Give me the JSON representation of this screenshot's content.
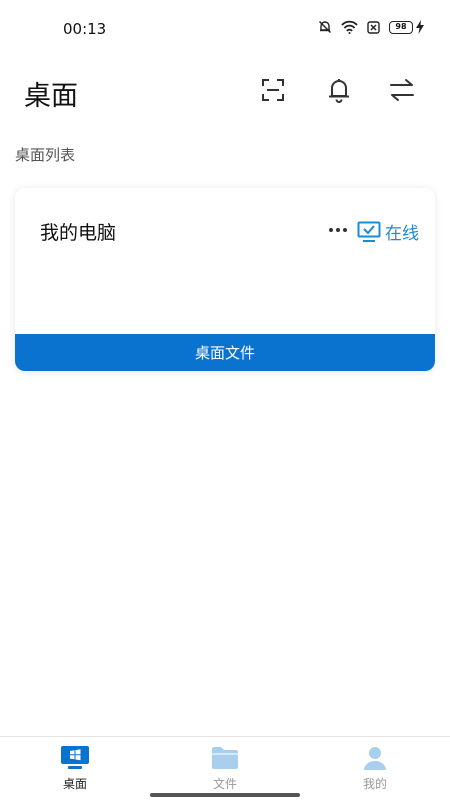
{
  "status_bar": {
    "time": "00:13",
    "battery": "98"
  },
  "header": {
    "title": "桌面"
  },
  "section": {
    "label": "桌面列表"
  },
  "devices": [
    {
      "name": "我的电脑",
      "status": "在线",
      "action": "桌面文件"
    }
  ],
  "bottom_nav": {
    "items": [
      {
        "label": "桌面",
        "active": true
      },
      {
        "label": "文件",
        "active": false
      },
      {
        "label": "我的",
        "active": false
      }
    ]
  },
  "colors": {
    "accent": "#0a72cf",
    "online": "#1b8bd6",
    "nav_icon_inactive": "#a9cfee"
  }
}
